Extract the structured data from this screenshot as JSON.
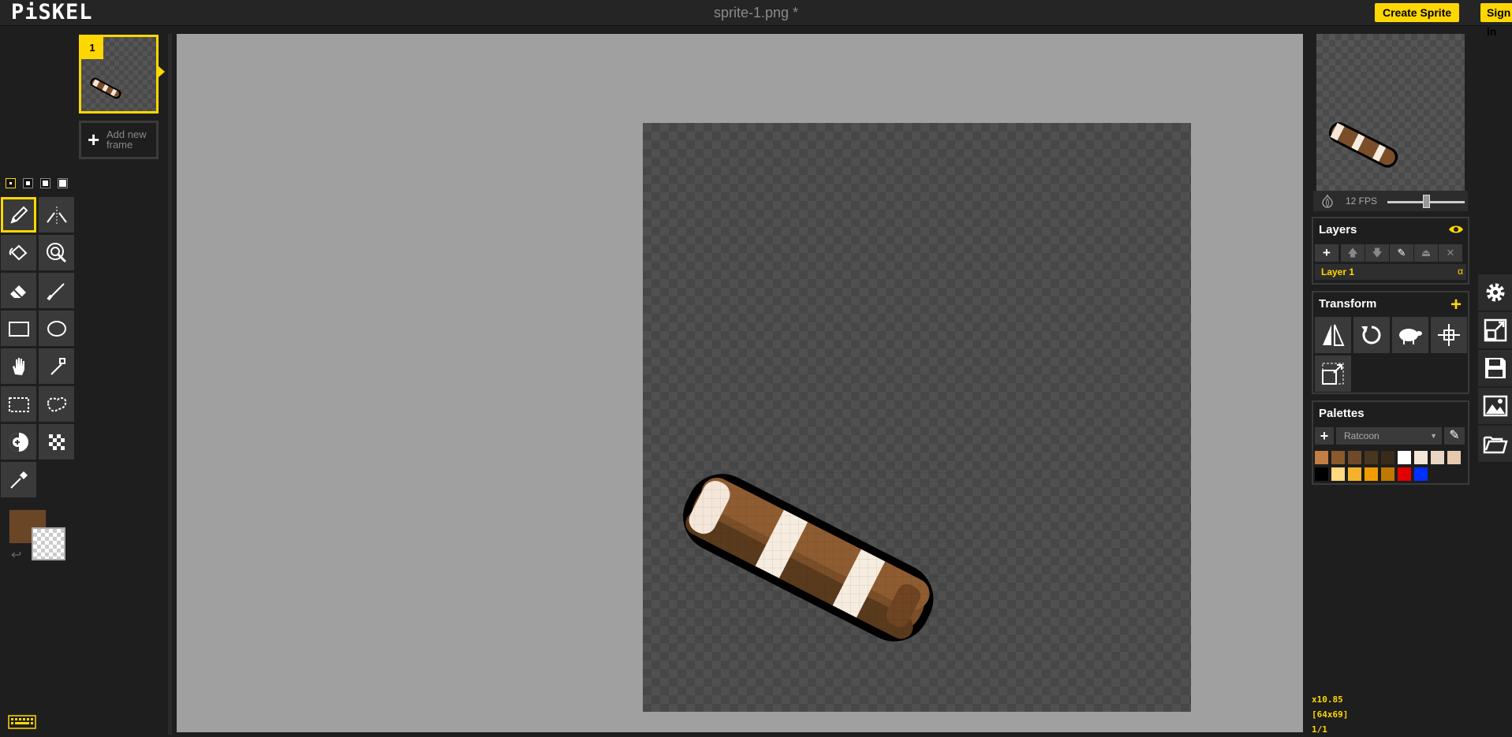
{
  "app": {
    "logo": "PiSKEL",
    "title": "sprite-1.png *"
  },
  "header": {
    "create_sprite": "Create Sprite",
    "sign_in": "Sign in"
  },
  "frames": {
    "selected_index": "1",
    "add_frame_label_line1": "Add new",
    "add_frame_label_line2": "frame"
  },
  "colors": {
    "primary": "#6b4626",
    "secondary": "transparent",
    "accent": "#ffd700"
  },
  "tools": [
    "pen-icon",
    "vertical-mirror-pen-icon",
    "paint-bucket-icon",
    "paint-all-same-color-icon",
    "eraser-icon",
    "stroke-icon",
    "rectangle-icon",
    "circle-icon",
    "move-hand-icon",
    "shape-selection-icon",
    "rectangle-selection-icon",
    "lasso-selection-icon",
    "lighten-icon",
    "dithering-icon",
    "color-picker-icon"
  ],
  "preview": {
    "fps_label": "12 FPS",
    "fps": 12
  },
  "layers": {
    "title": "Layers",
    "items": [
      {
        "name": "Layer 1",
        "alpha_label": "α"
      }
    ]
  },
  "transform": {
    "title": "Transform"
  },
  "palettes": {
    "title": "Palettes",
    "selected": "Ratcoon",
    "swatches": [
      "#c47e43",
      "#8b5a2b",
      "#6e4a2a",
      "#4a3520",
      "#3a2a18",
      "#ffffff",
      "#f4e6d8",
      "#ead6c4",
      "#e6c9ae",
      "#000000",
      "#ffd880",
      "#f4b22c",
      "#f29c00",
      "#c07800",
      "#e40000",
      "#0030ff"
    ]
  },
  "status": {
    "zoom": "x10.85",
    "size": "[64x69]",
    "frame": "1/1"
  }
}
